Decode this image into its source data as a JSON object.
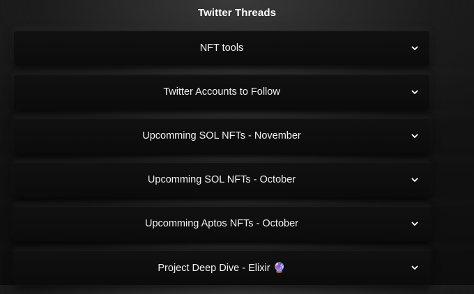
{
  "header": {
    "title": "Twitter Threads"
  },
  "threads": {
    "items": [
      {
        "label": "NFT tools"
      },
      {
        "label": "Twitter Accounts to Follow"
      },
      {
        "label": "Upcomming SOL NFTs - November"
      },
      {
        "label": "Upcomming SOL NFTs - October"
      },
      {
        "label": "Upcomming Aptos NFTs - October"
      },
      {
        "label": "Project Deep Dive - Elixir 🔮"
      }
    ],
    "expand_icon": "chevron-down-icon"
  }
}
